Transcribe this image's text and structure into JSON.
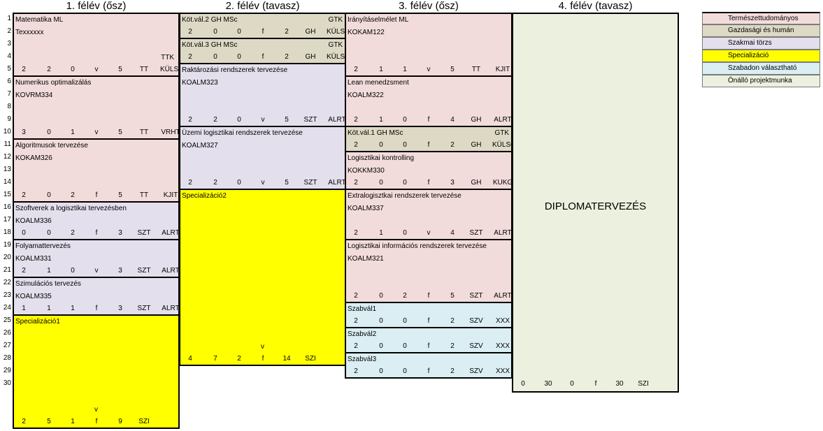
{
  "semesters": [
    "1. félév (ősz)",
    "2. félév (tavasz)",
    "3. félév (ősz)",
    "4. félév (tavasz)"
  ],
  "row_numbers": [
    "1",
    "2",
    "3",
    "4",
    "5",
    "6",
    "7",
    "8",
    "9",
    "10",
    "11",
    "12",
    "13",
    "14",
    "15",
    "16",
    "17",
    "18",
    "19",
    "20",
    "21",
    "22",
    "23",
    "24",
    "25",
    "26",
    "27",
    "28",
    "29",
    "30"
  ],
  "colors": {
    "termeszettudomanyos": "#f2dcdb",
    "gazdasagi": "#ddd9c4",
    "szakmai": "#e4dfec",
    "specializacio": "#ffff00",
    "szabad": "#daeef3",
    "projekt": "#ebf1de"
  },
  "legend": [
    {
      "label": "Természettudományos",
      "cat": "termeszettudomanyos"
    },
    {
      "label": "Gazdasági és humán",
      "cat": "gazdasagi"
    },
    {
      "label": "Szakmai törzs",
      "cat": "szakmai"
    },
    {
      "label": "Specializáció",
      "cat": "specializacio"
    },
    {
      "label": "Szabadon választható",
      "cat": "szabad"
    },
    {
      "label": "Önálló projektmunka",
      "cat": "projekt"
    }
  ],
  "courses": [
    {
      "sem": 0,
      "row": 1,
      "len": 5,
      "cat": "termeszettudomanyos",
      "name": "Matematika ML",
      "code": "Texxxxxx",
      "tag": "TTK",
      "credits": [
        "2",
        "2",
        "0",
        "v",
        "5",
        "TT",
        "KÜLSŐ"
      ]
    },
    {
      "sem": 0,
      "row": 6,
      "len": 5,
      "cat": "termeszettudomanyos",
      "name": "Numerikus optimalizálás",
      "code": "KOVRM334",
      "credits": [
        "3",
        "0",
        "1",
        "v",
        "5",
        "TT",
        "VRHT"
      ]
    },
    {
      "sem": 0,
      "row": 11,
      "len": 5,
      "cat": "termeszettudomanyos",
      "name": "Algoritmusok tervezése",
      "code": "KOKAM326",
      "credits": [
        "2",
        "0",
        "2",
        "f",
        "5",
        "TT",
        "KJIT"
      ]
    },
    {
      "sem": 0,
      "row": 16,
      "len": 3,
      "cat": "szakmai",
      "name": "Szoftverek a logisztikai tervezésben",
      "code": "KOALM336",
      "credits": [
        "0",
        "0",
        "2",
        "f",
        "3",
        "SZT",
        "ALRT"
      ]
    },
    {
      "sem": 0,
      "row": 19,
      "len": 3,
      "cat": "szakmai",
      "name": "Folyamattervezés",
      "code": "KOALM331",
      "credits": [
        "2",
        "1",
        "0",
        "v",
        "3",
        "SZT",
        "ALRT"
      ]
    },
    {
      "sem": 0,
      "row": 22,
      "len": 3,
      "cat": "szakmai",
      "name": "Szimulációs tervezés",
      "code": "KOALM335",
      "credits": [
        "1",
        "1",
        "1",
        "f",
        "3",
        "SZT",
        "ALRT"
      ]
    },
    {
      "sem": 0,
      "row": 25,
      "len": 9,
      "cat": "specializacio",
      "name": "Specializáció1",
      "v": "v",
      "credits": [
        "2",
        "5",
        "1",
        "f",
        "9",
        "SZI",
        ""
      ]
    },
    {
      "sem": 1,
      "row": 1,
      "len": 2,
      "cat": "gazdasagi",
      "name": "Köt.vál.2 GH MSc",
      "gtk": "GTK",
      "credits": [
        "2",
        "0",
        "0",
        "f",
        "2",
        "GH",
        "KÜLSŐ"
      ]
    },
    {
      "sem": 1,
      "row": 3,
      "len": 2,
      "cat": "gazdasagi",
      "name": "Köt.vál.3 GH MSc",
      "gtk": "GTK",
      "credits": [
        "2",
        "0",
        "0",
        "f",
        "2",
        "GH",
        "KÜLSŐ"
      ]
    },
    {
      "sem": 1,
      "row": 5,
      "len": 5,
      "cat": "szakmai",
      "name": "Raktározási rendszerek tervezése",
      "code": "KOALM323",
      "credits": [
        "2",
        "2",
        "0",
        "v",
        "5",
        "SZT",
        "ALRT"
      ]
    },
    {
      "sem": 1,
      "row": 10,
      "len": 5,
      "cat": "szakmai",
      "name": "Üzemi logisztikai rendszerek tervezése",
      "code": "KOALM327",
      "credits": [
        "2",
        "2",
        "0",
        "v",
        "5",
        "SZT",
        "ALRT"
      ]
    },
    {
      "sem": 1,
      "row": 15,
      "len": 14,
      "cat": "specializacio",
      "name": "Specializáció2",
      "v": "v",
      "credits": [
        "4",
        "7",
        "2",
        "f",
        "14",
        "SZI",
        ""
      ]
    },
    {
      "sem": 2,
      "row": 1,
      "len": 5,
      "cat": "termeszettudomanyos",
      "name": "Irányításelmélet ML",
      "code": "KOKAM122",
      "credits": [
        "2",
        "1",
        "1",
        "v",
        "5",
        "TT",
        "KJIT"
      ]
    },
    {
      "sem": 2,
      "row": 6,
      "len": 4,
      "cat": "termeszettudomanyos",
      "name": "Lean menedzsment",
      "code": "KOALM322",
      "credits": [
        "2",
        "1",
        "0",
        "f",
        "4",
        "GH",
        "ALRT"
      ]
    },
    {
      "sem": 2,
      "row": 10,
      "len": 2,
      "cat": "gazdasagi",
      "name": "Köt.vál.1 GH MSc",
      "gtk": "GTK",
      "credits": [
        "2",
        "0",
        "0",
        "f",
        "2",
        "GH",
        "KÜLSŐ"
      ]
    },
    {
      "sem": 2,
      "row": 12,
      "len": 3,
      "cat": "termeszettudomanyos",
      "name": "Logisztikai kontrolling",
      "code": "KOKKM330",
      "credits": [
        "2",
        "0",
        "0",
        "f",
        "3",
        "GH",
        "KUKG"
      ]
    },
    {
      "sem": 2,
      "row": 15,
      "len": 4,
      "cat": "termeszettudomanyos",
      "name": "Extralogisztkai rendszerek tervezése",
      "code": "KOALM337",
      "credits": [
        "2",
        "1",
        "0",
        "v",
        "4",
        "SZT",
        "ALRT"
      ]
    },
    {
      "sem": 2,
      "row": 19,
      "len": 5,
      "cat": "termeszettudomanyos",
      "name": "Logisztikai információs rendszerek tervezése",
      "code": "KOALM321",
      "credits": [
        "2",
        "0",
        "2",
        "f",
        "5",
        "SZT",
        "ALRT"
      ]
    },
    {
      "sem": 2,
      "row": 24,
      "len": 2,
      "cat": "szabad",
      "name": "Szabvál1",
      "credits": [
        "2",
        "0",
        "0",
        "f",
        "2",
        "SZV",
        "XXX"
      ]
    },
    {
      "sem": 2,
      "row": 26,
      "len": 2,
      "cat": "szabad",
      "name": "Szabvál2",
      "credits": [
        "2",
        "0",
        "0",
        "f",
        "2",
        "SZV",
        "XXX"
      ]
    },
    {
      "sem": 2,
      "row": 28,
      "len": 2,
      "cat": "szabad",
      "name": "Szabvál3",
      "credits": [
        "2",
        "0",
        "0",
        "f",
        "2",
        "SZV",
        "XXX"
      ]
    },
    {
      "sem": 3,
      "row": 1,
      "len": 30,
      "cat": "projekt",
      "name": "DIPLOMATERVEZÉS",
      "credits": [
        "0",
        "30",
        "0",
        "f",
        "30",
        "SZI",
        ""
      ]
    }
  ]
}
